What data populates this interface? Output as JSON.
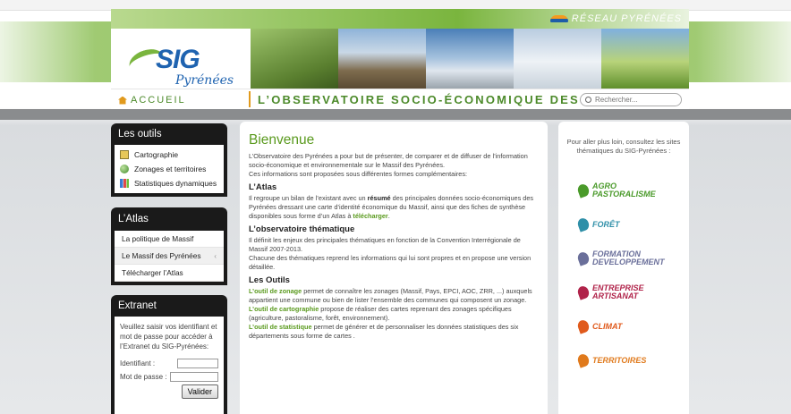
{
  "header": {
    "network": "RÉSEAU PYRÉNÉES",
    "logo_text": "SIG",
    "logo_subtitle": "Pyrénées",
    "home_label": "ACCUEIL",
    "tagline": "L’OBSERVATOIRE SOCIO-ÉCONOMIQUE DES PYRÉNÉES",
    "search_placeholder": "Rechercher..."
  },
  "outils": {
    "title": "Les outils",
    "items": [
      {
        "label": "Cartographie",
        "icon": "map-icon"
      },
      {
        "label": "Zonages et territoires",
        "icon": "globe-icon"
      },
      {
        "label": "Statistiques dynamiques",
        "icon": "chart-icon"
      }
    ]
  },
  "atlas": {
    "title": "L’Atlas",
    "items": [
      "La politique de Massif",
      "Le Massif des Pyrénées",
      "Télécharger l’Atlas"
    ],
    "active_marker": "‹"
  },
  "extranet": {
    "title": "Extranet",
    "intro": "Veuillez saisir vos identifiant et mot de passe pour accéder à l’Extranet du SIG-Pyrénées:",
    "login_label": "Identifiant :",
    "password_label": "Mot de passe :",
    "submit": "Valider"
  },
  "main": {
    "title": "Bienvenue",
    "intro1": "L’Observatoire des Pyrénées a pour but de présenter, de comparer et de diffuser de l’information socio-économique et environnementale sur le Massif des Pyrénées.",
    "intro2": "Ces informations sont proposées sous différentes formes complémentaires:",
    "atlas_title": "L’Atlas",
    "atlas_text_a": "Il regroupe un bilan de l’existant avec un ",
    "atlas_text_bold": "résumé",
    "atlas_text_b": " des principales données socio-économiques des Pyrénées dressant une carte d’identité économique du Massif, ainsi que des fiches de synthèse disponibles sous forme d’un Atlas à ",
    "atlas_link": "télécharger",
    "atlas_end": ".",
    "obs_title": "L’observatoire thématique",
    "obs_text1": "Il définit les enjeux des principales thématiques en fonction de la Convention Interrégionale de Massif 2007-2013.",
    "obs_text2": "Chacune des thématiques reprend les informations qui lui sont propres et en propose une version détaillée.",
    "tools_title": "Les Outils",
    "tool1_link": "L’outil de zonage",
    "tool1_text": " permet de connaître les zonages (Massif, Pays, EPCI, AOC, ZRR, ...) auxquels appartient une commune ou bien de lister l’ensemble des communes qui composent un zonage.",
    "tool2_link": "L’outil de cartographie",
    "tool2_text": " propose de réaliser des cartes reprenant des zonages spécifiques (agriculture, pastoralisme, forêt, environnement).",
    "tool3_link": "L’outil de statistique",
    "tool3_text": " permet de générer et de personnaliser les données statistiques des six départements sous forme de cartes ."
  },
  "side": {
    "intro": "Pour aller plus loin, consultez les sites thématiques du SIG-Pyrénées :",
    "themes": [
      {
        "line1": "AGRO",
        "line2": "PASTORALISME",
        "color": "#4a9a2a"
      },
      {
        "line1": "FORÊT",
        "line2": "",
        "color": "#2f8fa8"
      },
      {
        "line1": "FORMATION",
        "line2": "DEVELOPPEMENT",
        "color": "#6a6f9a"
      },
      {
        "line1": "ENTREPRISE",
        "line2": "ARTISANAT",
        "color": "#b0234a"
      },
      {
        "line1": "CLIMAT",
        "line2": "",
        "color": "#e05a1c"
      },
      {
        "line1": "TERRITOIRES",
        "line2": "",
        "color": "#e07a1c"
      }
    ]
  }
}
